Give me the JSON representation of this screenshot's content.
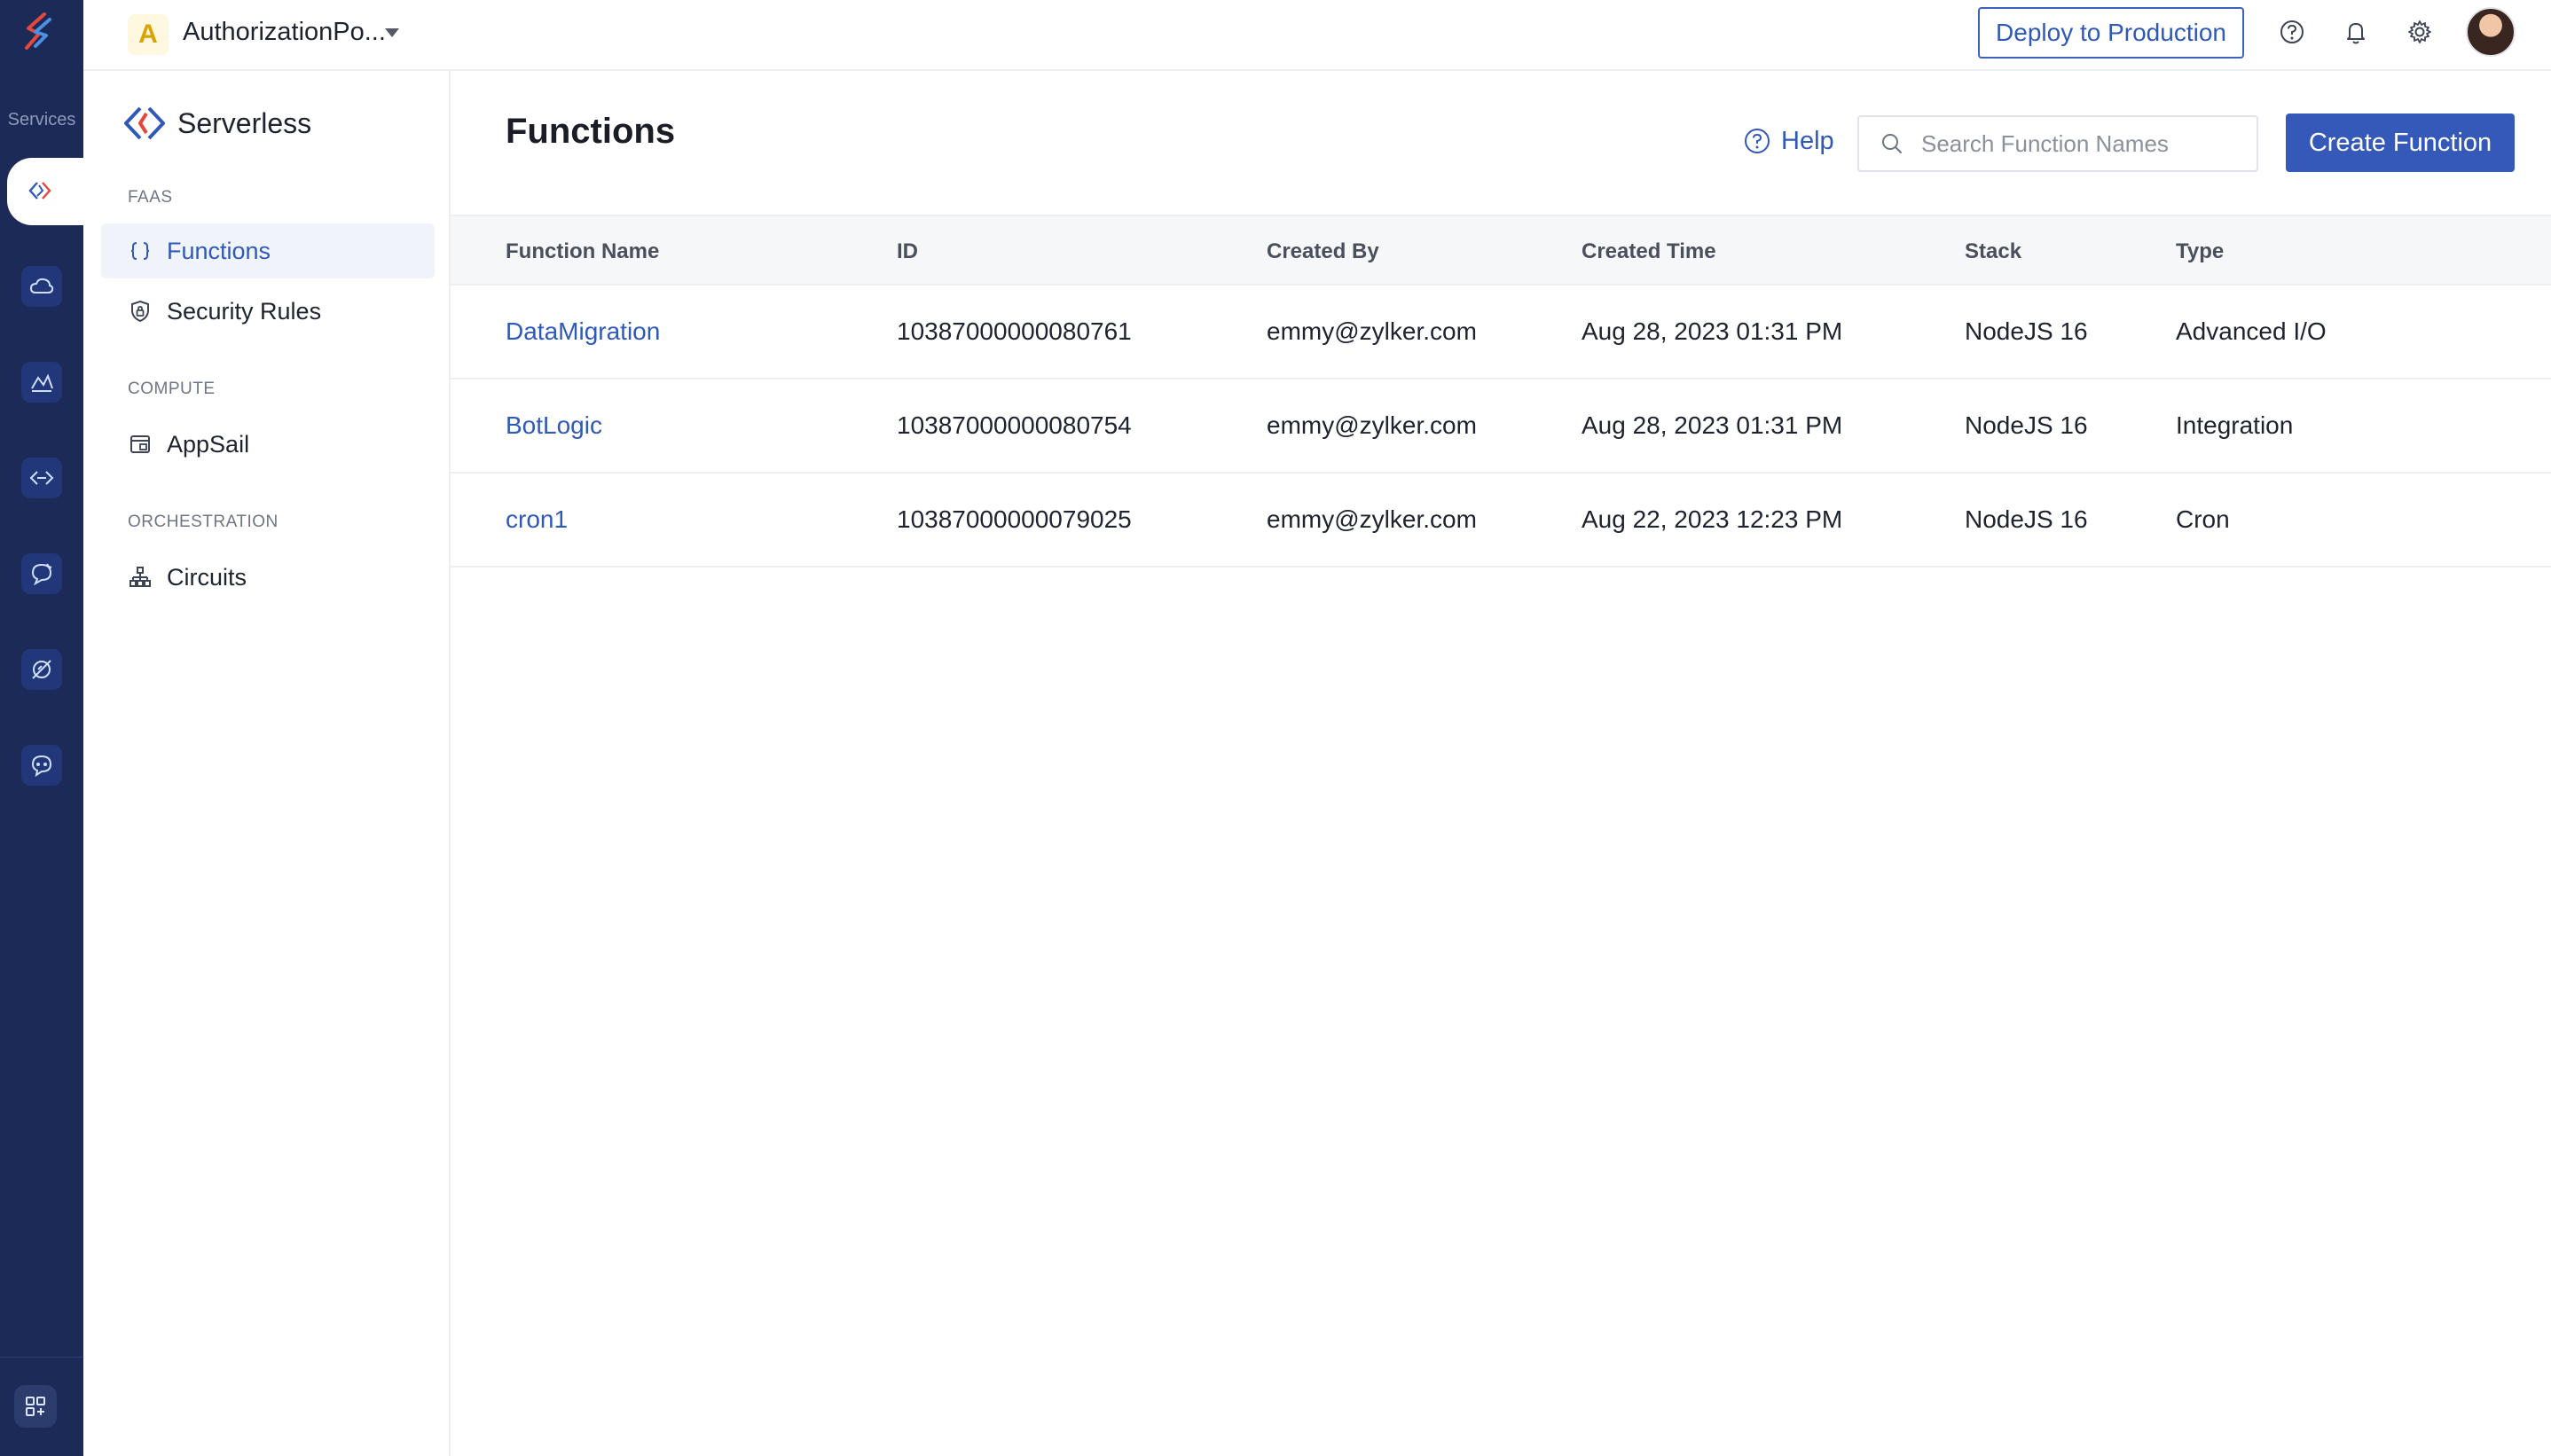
{
  "rail": {
    "services_label": "Services",
    "items": [
      "serverless-icon",
      "cloud-icon",
      "analytics-icon",
      "api-gateway-icon",
      "messaging-icon",
      "integration-icon",
      "support-icon"
    ]
  },
  "topbar": {
    "project_initial": "A",
    "project_name": "AuthorizationPo...",
    "deploy_label": "Deploy to Production"
  },
  "sidebar": {
    "title": "Serverless",
    "sections": [
      {
        "label": "FAAS",
        "items": [
          {
            "label": "Functions",
            "active": true
          },
          {
            "label": "Security Rules",
            "active": false
          }
        ]
      },
      {
        "label": "COMPUTE",
        "items": [
          {
            "label": "AppSail",
            "active": false
          }
        ]
      },
      {
        "label": "ORCHESTRATION",
        "items": [
          {
            "label": "Circuits",
            "active": false
          }
        ]
      }
    ]
  },
  "main": {
    "title": "Functions",
    "help_label": "Help",
    "search_placeholder": "Search Function Names",
    "create_label": "Create Function",
    "columns": [
      "Function Name",
      "ID",
      "Created By",
      "Created Time",
      "Stack",
      "Type"
    ],
    "rows": [
      [
        "DataMigration",
        "10387000000080761",
        "emmy@zylker.com",
        "Aug 28, 2023 01:31 PM",
        "NodeJS 16",
        "Advanced I/O"
      ],
      [
        "BotLogic",
        "10387000000080754",
        "emmy@zylker.com",
        "Aug 28, 2023 01:31 PM",
        "NodeJS 16",
        "Integration"
      ],
      [
        "cron1",
        "10387000000079025",
        "emmy@zylker.com",
        "Aug 22, 2023 12:23 PM",
        "NodeJS 16",
        "Cron"
      ]
    ]
  },
  "colors": {
    "rail_bg": "#1b2a56",
    "accent": "#3559b9",
    "link": "#2f59b8"
  }
}
